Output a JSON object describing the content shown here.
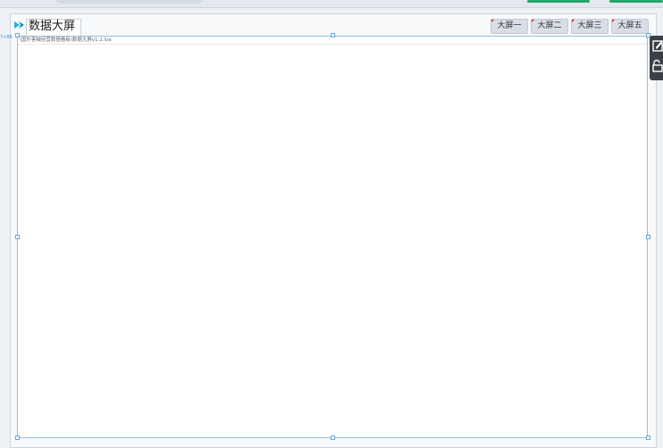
{
  "app": {
    "title": "数据大屏",
    "file_path": "\\国外客械经营数据看板\\数据大屏v1.2.lva",
    "side_label": "7×88"
  },
  "nav": {
    "buttons": [
      {
        "label": "大屏一"
      },
      {
        "label": "大屏二"
      },
      {
        "label": "大屏三"
      },
      {
        "label": "大屏五"
      }
    ]
  },
  "tools": {
    "items": [
      {
        "icon": "edit-icon"
      },
      {
        "icon": "unlock-icon"
      }
    ]
  },
  "colors": {
    "accent": "#8ec0e6",
    "marker": "#e02020",
    "logo": "#27b0c8",
    "toolbar_bg": "#3b4046"
  }
}
